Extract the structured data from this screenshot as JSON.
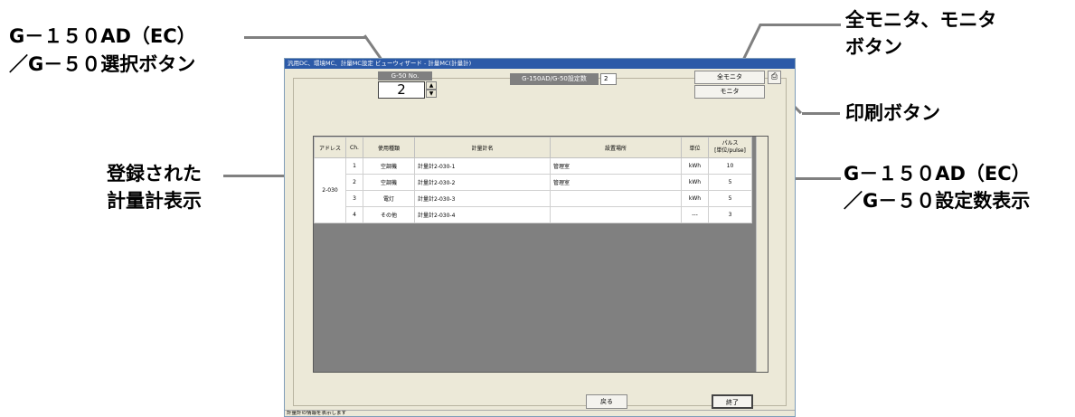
{
  "callouts": {
    "select_button_line1": "G－１５０AD（EC）",
    "select_button_line2": "／G－５０選択ボタン",
    "registered_line1": "登録された",
    "registered_line2": "計量計表示",
    "monitor_line1": "全モニタ、モニタ",
    "monitor_line2": "ボタン",
    "print_button": "印刷ボタン",
    "setcount_line1": "G－１５０AD（EC）",
    "setcount_line2": "／G－５０設定数表示"
  },
  "window": {
    "title": "汎用DC、環境MC、計量MC設定 ビューウィザード - 計量MC(計量計)",
    "g50_label": "G-50 No.",
    "g50_value": "2",
    "spin_up": "▲",
    "spin_down": "▼",
    "setcount_label": "G-150AD/G-50設定数",
    "setcount_value": "2",
    "all_monitor_button": "全モニタ",
    "monitor_button": "モニタ",
    "print_icon": "⎙",
    "back_button": "戻る",
    "exit_button": "終了",
    "status_text": "計量計の情報を表示します"
  },
  "table": {
    "headers": [
      "アドレス",
      "Ch.",
      "使用種類",
      "計量計名",
      "設置場所",
      "単位",
      "パルス\n[単位/pulse]"
    ],
    "address": "2-030",
    "rows": [
      {
        "ch": "1",
        "type": "空調機",
        "name": "計量計2-030-1",
        "location": "管理室",
        "unit": "kWh",
        "pulse": "10"
      },
      {
        "ch": "2",
        "type": "空調機",
        "name": "計量計2-030-2",
        "location": "管理室",
        "unit": "kWh",
        "pulse": "5"
      },
      {
        "ch": "3",
        "type": "電灯",
        "name": "計量計2-030-3",
        "location": "",
        "unit": "kWh",
        "pulse": "5"
      },
      {
        "ch": "4",
        "type": "その他",
        "name": "計量計2-030-4",
        "location": "",
        "unit": "---",
        "pulse": "3"
      }
    ]
  }
}
